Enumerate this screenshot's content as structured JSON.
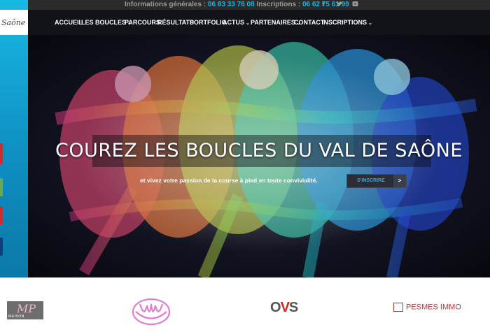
{
  "topbar": {
    "info_label": "Informations générales : ",
    "info_phone": "06 83 33 76 08",
    "insc_label": " Inscriptions : ",
    "insc_phone": "06 62 75 61 99",
    "social_icons": [
      "facebook-icon",
      "twitter-icon",
      "youtube-icon"
    ]
  },
  "logo": {
    "text": "Saône"
  },
  "nav": {
    "items": [
      {
        "label": "ACCUEIL",
        "active": true,
        "dropdown": false
      },
      {
        "label": "LES BOUCLES",
        "active": true,
        "dropdown": true
      },
      {
        "label": "PARCOURS",
        "active": false,
        "dropdown": false
      },
      {
        "label": "RÉSULTATS",
        "active": false,
        "dropdown": false
      },
      {
        "label": "PORTFOLIO",
        "active": false,
        "dropdown": false
      },
      {
        "label": "ACTUS",
        "active": true,
        "dropdown": true
      },
      {
        "label": "PARTENAIRES",
        "active": false,
        "dropdown": true
      },
      {
        "label": "CONTACT",
        "active": true,
        "dropdown": false
      },
      {
        "label": "INSCRIPTIONS",
        "active": false,
        "dropdown": true
      }
    ]
  },
  "hero": {
    "headline": "COUREZ LES BOUCLES DU VAL DE SAÔNE",
    "subtitle": "et vivez votre passion de la course à pied en toute convivialité.",
    "cta_label": "S'INSCRIRE",
    "cta_arrow": ">"
  },
  "partners": {
    "logo1_mark": "MP",
    "logo1_text": "MAISON",
    "logo3_text_a": "O",
    "logo3_text_b": "V",
    "logo3_text_c": "S",
    "logo4_text": "PESMES IMMO"
  },
  "colors": {
    "accent": "#1fb3e0",
    "nav_bg": "#111319",
    "topbar_bg": "#2b2b2b"
  }
}
